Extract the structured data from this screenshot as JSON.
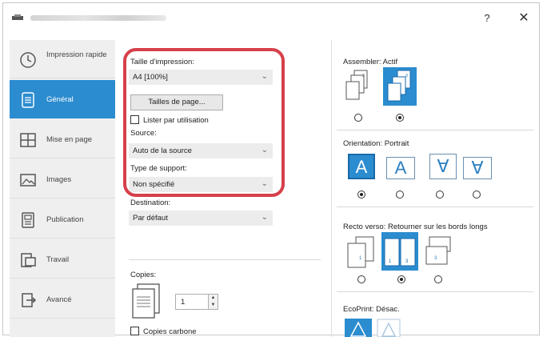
{
  "window": {
    "help_label": "?",
    "close_label": "✕"
  },
  "sidebar": {
    "items": [
      {
        "label": "Impression rapide",
        "icon": "clock-icon"
      },
      {
        "label": "Général",
        "icon": "document-icon"
      },
      {
        "label": "Mise en page",
        "icon": "layout-grid-icon"
      },
      {
        "label": "Images",
        "icon": "image-icon"
      },
      {
        "label": "Publication",
        "icon": "publication-icon"
      },
      {
        "label": "Travail",
        "icon": "job-icon"
      },
      {
        "label": "Avancé",
        "icon": "advanced-icon"
      }
    ]
  },
  "general": {
    "print_size_label": "Taille d'impression:",
    "print_size_value": "A4 [100%]",
    "page_sizes_button": "Tailles de page...",
    "list_by_use_label": "Lister par utilisation",
    "source_label": "Source:",
    "source_value": "Auto de la source",
    "media_type_label": "Type de support:",
    "media_type_value": "Non spécifié",
    "destination_label": "Destination:",
    "destination_value": "Par défaut",
    "copies_label": "Copies:",
    "copies_value": "1",
    "carbon_copies_label": "Copies carbone"
  },
  "right": {
    "collate_label": "Assembler: Actif",
    "orientation_label": "Orientation: Portrait",
    "orientation_glyphs": [
      "A",
      "A",
      "∀",
      "∀"
    ],
    "duplex_label": "Recto verso: Retourner sur les bords longs",
    "ecoprint_label": "EcoPrint: Désac."
  },
  "colors": {
    "accent": "#2b8ccf",
    "highlight": "#d6404a"
  }
}
